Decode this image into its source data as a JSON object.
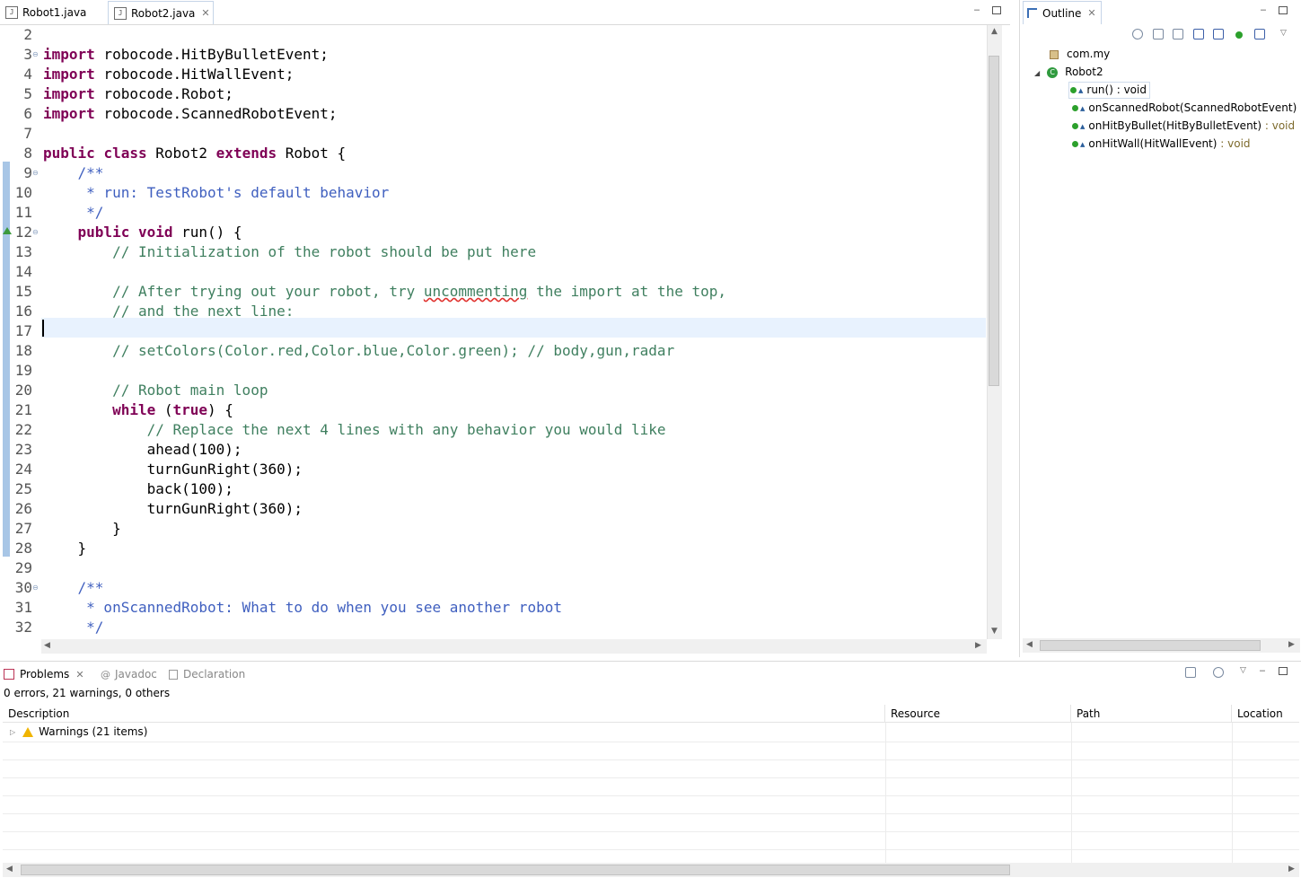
{
  "editor": {
    "tabs": [
      {
        "label": "Robot1.java",
        "active": false
      },
      {
        "label": "Robot2.java",
        "active": true
      }
    ],
    "lines": [
      {
        "n": "2",
        "segs": []
      },
      {
        "n": "3",
        "fold": true,
        "segs": [
          {
            "c": "kw",
            "t": "import"
          },
          {
            "t": " robocode.HitByBulletEvent;"
          }
        ]
      },
      {
        "n": "4",
        "segs": [
          {
            "c": "kw",
            "t": "import"
          },
          {
            "t": " robocode.HitWallEvent;"
          }
        ]
      },
      {
        "n": "5",
        "segs": [
          {
            "c": "kw",
            "t": "import"
          },
          {
            "t": " robocode.Robot;"
          }
        ]
      },
      {
        "n": "6",
        "segs": [
          {
            "c": "kw",
            "t": "import"
          },
          {
            "t": " robocode.ScannedRobotEvent;"
          }
        ]
      },
      {
        "n": "7",
        "segs": []
      },
      {
        "n": "8",
        "segs": [
          {
            "c": "kw",
            "t": "public"
          },
          {
            "t": " "
          },
          {
            "c": "kw",
            "t": "class"
          },
          {
            "t": " Robot2 "
          },
          {
            "c": "kw",
            "t": "extends"
          },
          {
            "t": " Robot {"
          }
        ]
      },
      {
        "n": "9",
        "fold": true,
        "segs": [
          {
            "t": "    "
          },
          {
            "c": "jd",
            "t": "/**"
          }
        ]
      },
      {
        "n": "10",
        "segs": [
          {
            "c": "jd",
            "t": "     * run: TestRobot's default behavior"
          }
        ]
      },
      {
        "n": "11",
        "segs": [
          {
            "c": "jd",
            "t": "     */"
          }
        ]
      },
      {
        "n": "12",
        "fold": true,
        "override": true,
        "segs": [
          {
            "t": "    "
          },
          {
            "c": "kw",
            "t": "public"
          },
          {
            "t": " "
          },
          {
            "c": "kw",
            "t": "void"
          },
          {
            "t": " run() {"
          }
        ]
      },
      {
        "n": "13",
        "segs": [
          {
            "c": "cm",
            "t": "        // Initialization of the robot should be put here"
          }
        ]
      },
      {
        "n": "14",
        "segs": []
      },
      {
        "n": "15",
        "segs": [
          {
            "c": "cm",
            "t": "        // After trying out your robot, try "
          },
          {
            "c": "cm sq",
            "t": "uncommenting"
          },
          {
            "c": "cm",
            "t": " the import at the top,"
          }
        ]
      },
      {
        "n": "16",
        "segs": [
          {
            "c": "cm",
            "t": "        // and the next line:"
          }
        ]
      },
      {
        "n": "17",
        "segs": []
      },
      {
        "n": "18",
        "segs": [
          {
            "c": "cm",
            "t": "        // setColors(Color.red,Color.blue,Color.green); // body,gun,radar"
          }
        ]
      },
      {
        "n": "19",
        "segs": []
      },
      {
        "n": "20",
        "segs": [
          {
            "c": "cm",
            "t": "        // Robot main loop"
          }
        ]
      },
      {
        "n": "21",
        "segs": [
          {
            "t": "        "
          },
          {
            "c": "kw",
            "t": "while"
          },
          {
            "t": " ("
          },
          {
            "c": "kw",
            "t": "true"
          },
          {
            "t": ") {"
          }
        ]
      },
      {
        "n": "22",
        "segs": [
          {
            "c": "cm",
            "t": "            // Replace the next 4 lines with any behavior you would like"
          }
        ]
      },
      {
        "n": "23",
        "segs": [
          {
            "t": "            ahead(100);"
          }
        ]
      },
      {
        "n": "24",
        "segs": [
          {
            "t": "            turnGunRight(360);"
          }
        ]
      },
      {
        "n": "25",
        "segs": [
          {
            "t": "            back(100);"
          }
        ]
      },
      {
        "n": "26",
        "segs": [
          {
            "t": "            turnGunRight(360);"
          }
        ]
      },
      {
        "n": "27",
        "segs": [
          {
            "t": "        }"
          }
        ]
      },
      {
        "n": "28",
        "segs": [
          {
            "t": "    }"
          }
        ]
      },
      {
        "n": "29",
        "segs": []
      },
      {
        "n": "30",
        "fold": true,
        "segs": [
          {
            "t": "    "
          },
          {
            "c": "jd",
            "t": "/**"
          }
        ]
      },
      {
        "n": "31",
        "segs": [
          {
            "c": "jd",
            "t": "     * onScannedRobot: What to do when you see another robot"
          }
        ]
      },
      {
        "n": "32",
        "segs": [
          {
            "c": "jd",
            "t": "     */"
          }
        ]
      }
    ]
  },
  "outline": {
    "tab_label": "Outline",
    "package": "com.my",
    "class_name": "Robot2",
    "members": [
      {
        "name": "run()",
        "type": " : void",
        "selected": true
      },
      {
        "name": "onScannedRobot(ScannedRobotEvent)",
        "type": ""
      },
      {
        "name": "onHitByBullet(HitByBulletEvent)",
        "type": " : void"
      },
      {
        "name": "onHitWall(HitWallEvent)",
        "type": " : void"
      }
    ]
  },
  "problems": {
    "tabs": [
      {
        "label": "Problems",
        "active": true,
        "icon": "problems-icon"
      },
      {
        "label": "Javadoc",
        "active": false,
        "icon": "javadoc-icon"
      },
      {
        "label": "Declaration",
        "active": false,
        "icon": "declaration-icon"
      }
    ],
    "summary": "0 errors, 21 warnings, 0 others",
    "columns": [
      "Description",
      "Resource",
      "Path",
      "Location"
    ],
    "group_label": "Warnings (21 items)"
  },
  "colors": {
    "keyword": "#7f0055",
    "comment": "#3f7f5f",
    "javadoc": "#3f5fbf",
    "current_line": "#e8f2fe",
    "change_bar": "#a8c6e6"
  }
}
